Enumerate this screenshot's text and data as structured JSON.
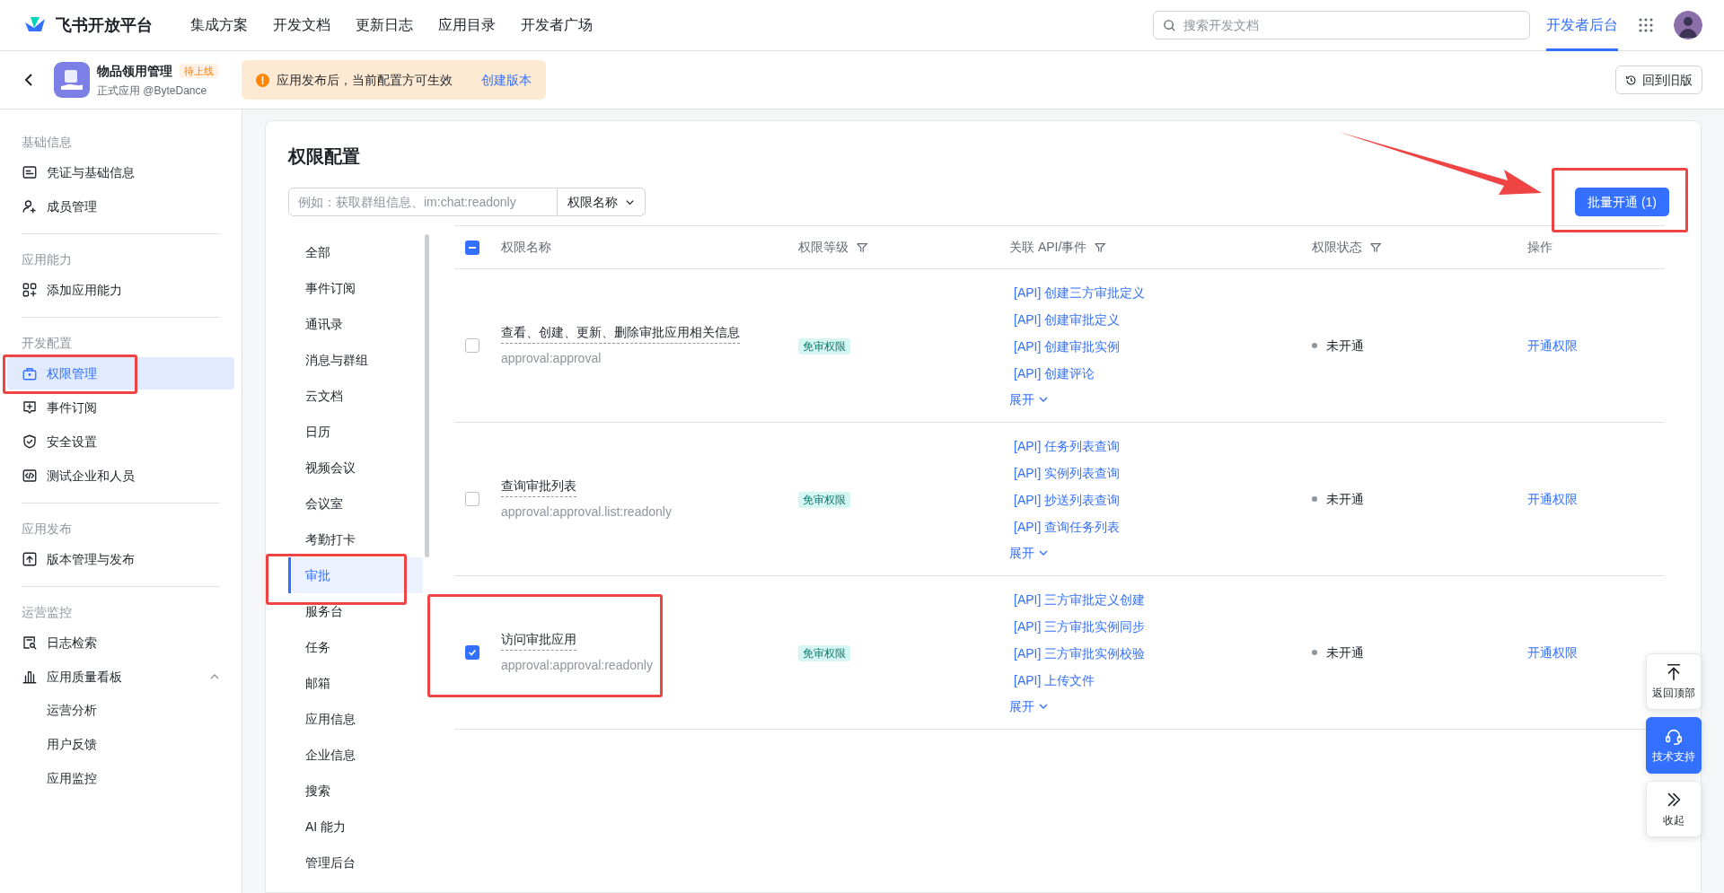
{
  "topbar": {
    "brand": "飞书开放平台",
    "nav": [
      {
        "label": "集成方案",
        "selected": false
      },
      {
        "label": "开发文档",
        "selected": false
      },
      {
        "label": "更新日志",
        "selected": false
      },
      {
        "label": "应用目录",
        "selected": false
      },
      {
        "label": "开发者广场",
        "selected": false
      },
      {
        "label": "开发者后台",
        "selected": true
      }
    ],
    "search": {
      "placeholder": "搜索开发文档"
    }
  },
  "app_header": {
    "name": "物品领用管理",
    "badge": "待上线",
    "subtitle": "正式应用 @ByteDance",
    "notice": "应用发布后，当前配置方可生效",
    "notice_link": "创建版本",
    "old_version_button": "回到旧版"
  },
  "sidebar": {
    "sections": [
      {
        "title": "基础信息",
        "items": [
          {
            "label": "凭证与基础信息",
            "kind": "card",
            "selected": false,
            "highlighted": false
          },
          {
            "label": "成员管理",
            "kind": "user",
            "selected": false,
            "highlighted": false
          }
        ]
      },
      {
        "title": "应用能力",
        "items": [
          {
            "label": "添加应用能力",
            "kind": "grid",
            "selected": false,
            "highlighted": false
          }
        ]
      },
      {
        "title": "开发配置",
        "items": [
          {
            "label": "权限管理",
            "kind": "lock",
            "selected": true,
            "highlighted": true
          },
          {
            "label": "事件订阅",
            "kind": "event",
            "selected": false,
            "highlighted": false
          },
          {
            "label": "安全设置",
            "kind": "shield",
            "selected": false,
            "highlighted": false
          },
          {
            "label": "测试企业和人员",
            "kind": "code",
            "selected": false,
            "highlighted": false
          }
        ]
      },
      {
        "title": "应用发布",
        "items": [
          {
            "label": "版本管理与发布",
            "kind": "upload",
            "selected": false,
            "highlighted": false
          }
        ]
      },
      {
        "title": "运营监控",
        "items": [
          {
            "label": "日志检索",
            "kind": "log",
            "selected": false,
            "highlighted": false
          },
          {
            "label": "应用质量看板",
            "kind": "chart",
            "selected": false,
            "highlighted": false,
            "expanded": true,
            "children": [
              {
                "label": "运营分析"
              },
              {
                "label": "用户反馈"
              },
              {
                "label": "应用监控"
              }
            ]
          }
        ]
      }
    ]
  },
  "panel": {
    "title": "权限配置",
    "search": {
      "placeholder": "例如：获取群组信息、im:chat:readonly"
    },
    "search_scope": "权限名称",
    "batch_button": {
      "label": "批量开通 (1)",
      "highlighted": true
    },
    "categories": [
      {
        "label": "全部",
        "selected": false
      },
      {
        "label": "事件订阅",
        "selected": false
      },
      {
        "label": "通讯录",
        "selected": false
      },
      {
        "label": "消息与群组",
        "selected": false
      },
      {
        "label": "云文档",
        "selected": false
      },
      {
        "label": "日历",
        "selected": false
      },
      {
        "label": "视频会议",
        "selected": false
      },
      {
        "label": "会议室",
        "selected": false
      },
      {
        "label": "考勤打卡",
        "selected": false
      },
      {
        "label": "审批",
        "selected": true,
        "highlighted": true
      },
      {
        "label": "服务台",
        "selected": false
      },
      {
        "label": "任务",
        "selected": false
      },
      {
        "label": "邮箱",
        "selected": false
      },
      {
        "label": "应用信息",
        "selected": false
      },
      {
        "label": "企业信息",
        "selected": false
      },
      {
        "label": "搜索",
        "selected": false
      },
      {
        "label": "AI 能力",
        "selected": false
      },
      {
        "label": "管理后台",
        "selected": false
      }
    ],
    "table": {
      "select_all": {
        "indeterminate": true
      },
      "columns": [
        "权限名称",
        "权限等级",
        "关联 API/事件",
        "权限状态",
        "操作"
      ],
      "rows": [
        {
          "checked": false,
          "highlighted": false,
          "name": "查看、创建、更新、删除审批应用相关信息",
          "scope": "approval:approval",
          "level": "免审权限",
          "apis": [
            "[API] 创建三方审批定义",
            "[API] 创建审批定义",
            "[API] 创建审批实例",
            "[API] 创建评论"
          ],
          "expand": "展开",
          "status": "未开通",
          "action": "开通权限"
        },
        {
          "checked": false,
          "highlighted": false,
          "name": "查询审批列表",
          "scope": "approval:approval.list:readonly",
          "level": "免审权限",
          "apis": [
            "[API] 任务列表查询",
            "[API] 实例列表查询",
            "[API] 抄送列表查询",
            "[API] 查询任务列表"
          ],
          "expand": "展开",
          "status": "未开通",
          "action": "开通权限"
        },
        {
          "checked": true,
          "highlighted": true,
          "name": "访问审批应用",
          "scope": "approval:approval:readonly",
          "level": "免审权限",
          "apis": [
            "[API] 三方审批定义创建",
            "[API] 三方审批实例同步",
            "[API] 三方审批实例校验",
            "[API] 上传文件"
          ],
          "expand": "展开",
          "status": "未开通",
          "action": "开通权限"
        }
      ]
    }
  },
  "float_buttons": [
    {
      "label": "返回顶部",
      "kind": "top",
      "selected": false
    },
    {
      "label": "技术支持",
      "kind": "headset",
      "selected": true
    },
    {
      "label": "收起",
      "kind": "collapse",
      "selected": false
    }
  ]
}
